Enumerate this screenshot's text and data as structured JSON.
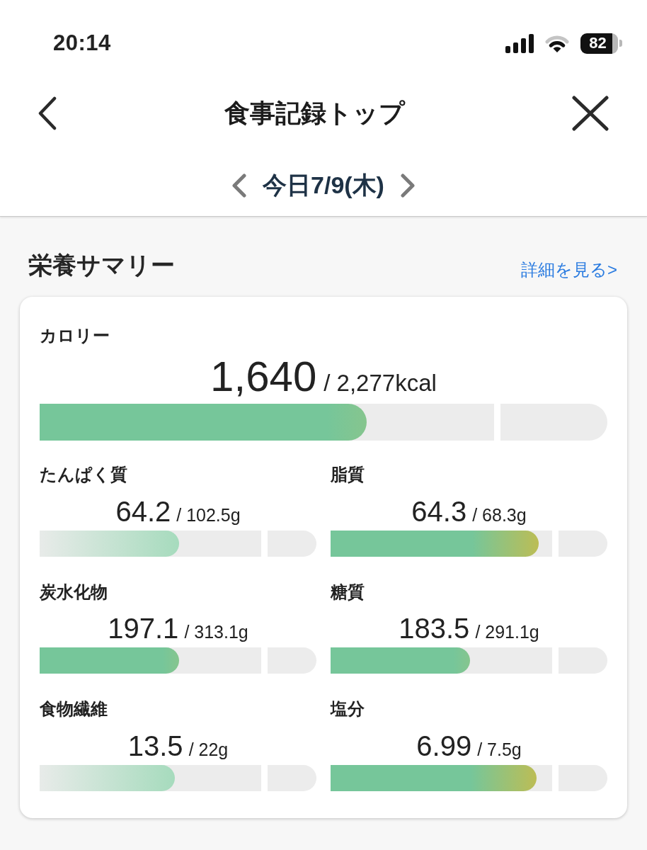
{
  "status_bar": {
    "time": "20:14",
    "battery": "82"
  },
  "header": {
    "title": "食事記録トップ"
  },
  "date_nav": {
    "date": "今日7/9(木)"
  },
  "summary": {
    "title": "栄養サマリー",
    "details_link": "詳細を見る>",
    "calorie": {
      "label": "カロリー",
      "value": "1,640",
      "target": "/ 2,277kcal",
      "level": 0.72,
      "kind": "good"
    },
    "nutrients": [
      {
        "label": "たんぱく質",
        "value": "64.2",
        "target": "/ 102.5g",
        "level": 0.63,
        "kind": "low"
      },
      {
        "label": "脂質",
        "value": "64.3",
        "target": "/ 68.3g",
        "level": 0.94,
        "kind": "high"
      },
      {
        "label": "炭水化物",
        "value": "197.1",
        "target": "/ 313.1g",
        "level": 0.63,
        "kind": "good"
      },
      {
        "label": "糖質",
        "value": "183.5",
        "target": "/ 291.1g",
        "level": 0.63,
        "kind": "good"
      },
      {
        "label": "食物繊維",
        "value": "13.5",
        "target": "/ 22g",
        "level": 0.61,
        "kind": "low"
      },
      {
        "label": "塩分",
        "value": "6.99",
        "target": "/ 7.5g",
        "level": 0.93,
        "kind": "high"
      }
    ]
  }
}
